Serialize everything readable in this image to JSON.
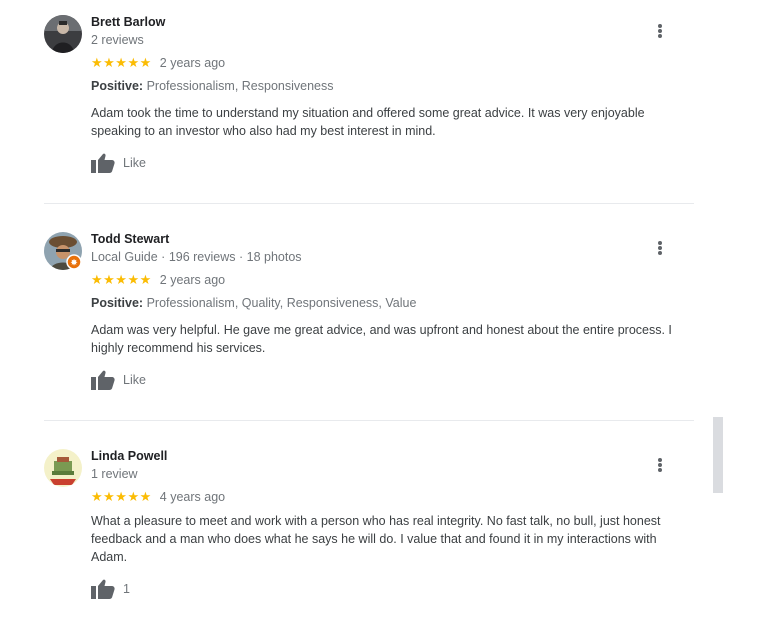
{
  "reviews": [
    {
      "name": "Brett Barlow",
      "sub": "2 reviews",
      "stars": "★★★★★",
      "date": "2 years ago",
      "positive_label": "Positive:",
      "positive_values": "Professionalism, Responsiveness",
      "text": "Adam took the time to understand my situation and offered some great advice. It was very enjoyable speaking to an investor who also had my best interest in mind.",
      "like_label": "Like"
    },
    {
      "name": "Todd Stewart",
      "sub": "Local Guide · 196 reviews · 18 photos",
      "stars": "★★★★★",
      "date": "2 years ago",
      "positive_label": "Positive:",
      "positive_values": "Professionalism, Quality, Responsiveness, Value",
      "text": "Adam was very helpful.  He gave me great advice, and was upfront and honest about the entire process. I highly recommend his services.",
      "like_label": "Like"
    },
    {
      "name": "Linda Powell",
      "sub": "1 review",
      "stars": "★★★★★",
      "date": "4 years ago",
      "text": "What a pleasure to meet and work with a person who has real integrity.  No fast talk, no bull, just honest feedback and a man who does what he says he will do.  I value that and found it in my interactions with Adam.",
      "like_label": "1"
    }
  ],
  "colors": {
    "star": "#fbbc04",
    "muted_text": "#70757a",
    "body_text": "#3c4043",
    "divider": "#e8eaed",
    "local_guide_badge": "#e8710a"
  },
  "icons": [
    "thumbs-up-icon",
    "more-vert-icon",
    "local-guide-badge-icon"
  ]
}
